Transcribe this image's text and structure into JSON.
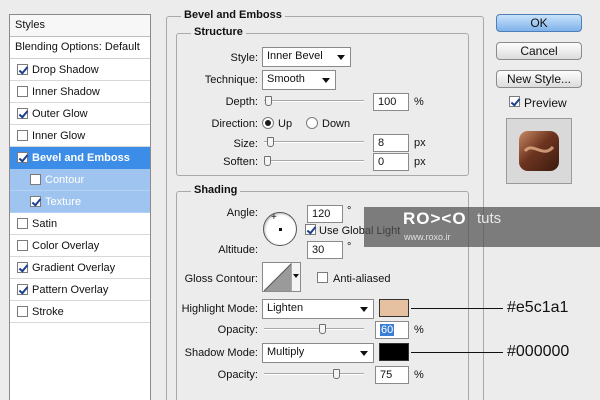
{
  "sidebar": {
    "title": "Styles",
    "blending_options": "Blending Options: Default",
    "items": [
      {
        "label": "Drop Shadow",
        "checked": true
      },
      {
        "label": "Inner Shadow",
        "checked": false
      },
      {
        "label": "Outer Glow",
        "checked": true
      },
      {
        "label": "Inner Glow",
        "checked": false
      },
      {
        "label": "Bevel and Emboss",
        "checked": true
      },
      {
        "label": "Contour",
        "checked": false
      },
      {
        "label": "Texture",
        "checked": true
      },
      {
        "label": "Satin",
        "checked": false
      },
      {
        "label": "Color Overlay",
        "checked": false
      },
      {
        "label": "Gradient Overlay",
        "checked": true
      },
      {
        "label": "Pattern Overlay",
        "checked": true
      },
      {
        "label": "Stroke",
        "checked": false
      }
    ]
  },
  "bevel": {
    "title": "Bevel and Emboss",
    "structure": {
      "title": "Structure",
      "style_label": "Style:",
      "style_value": "Inner Bevel",
      "technique_label": "Technique:",
      "technique_value": "Smooth",
      "depth_label": "Depth:",
      "depth_value": "100",
      "depth_level": 0.01,
      "depth_unit": "%",
      "direction_label": "Direction:",
      "direction_up": "Up",
      "direction_down": "Down",
      "direction_selected": "Up",
      "size_label": "Size:",
      "size_value": "8",
      "size_level": 0.03,
      "size_unit": "px",
      "soften_label": "Soften:",
      "soften_value": "0",
      "soften_level": 0.0,
      "soften_unit": "px"
    },
    "shading": {
      "title": "Shading",
      "angle_label": "Angle:",
      "angle_value": "120",
      "angle_unit": "°",
      "use_global_light_label": "Use Global Light",
      "use_global_light_checked": true,
      "altitude_label": "Altitude:",
      "altitude_value": "30",
      "altitude_unit": "°",
      "gloss_contour_label": "Gloss Contour:",
      "anti_aliased_label": "Anti-aliased",
      "anti_aliased_checked": false,
      "highlight_mode_label": "Highlight Mode:",
      "highlight_mode_value": "Lighten",
      "highlight_color": "#e5c1a1",
      "highlight_opacity_label": "Opacity:",
      "highlight_opacity_value": "60",
      "highlight_opacity_level": 0.6,
      "highlight_opacity_unit": "%",
      "shadow_mode_label": "Shadow Mode:",
      "shadow_mode_value": "Multiply",
      "shadow_color": "#000000",
      "shadow_opacity_label": "Opacity:",
      "shadow_opacity_value": "75",
      "shadow_opacity_level": 0.75,
      "shadow_opacity_unit": "%"
    }
  },
  "buttons": {
    "ok": "OK",
    "cancel": "Cancel",
    "new_style": "New Style...",
    "preview_label": "Preview",
    "preview_checked": true
  },
  "watermark": {
    "logo": "RO><O",
    "tuts": "tuts",
    "url": "www.roxo.ir"
  },
  "annotations": {
    "highlight_hex": "#e5c1a1",
    "shadow_hex": "#000000"
  },
  "colors": {
    "selection": "#3b8de7",
    "sub_selection": "#9fc4ef",
    "primary_button": "#7fb2ea"
  }
}
